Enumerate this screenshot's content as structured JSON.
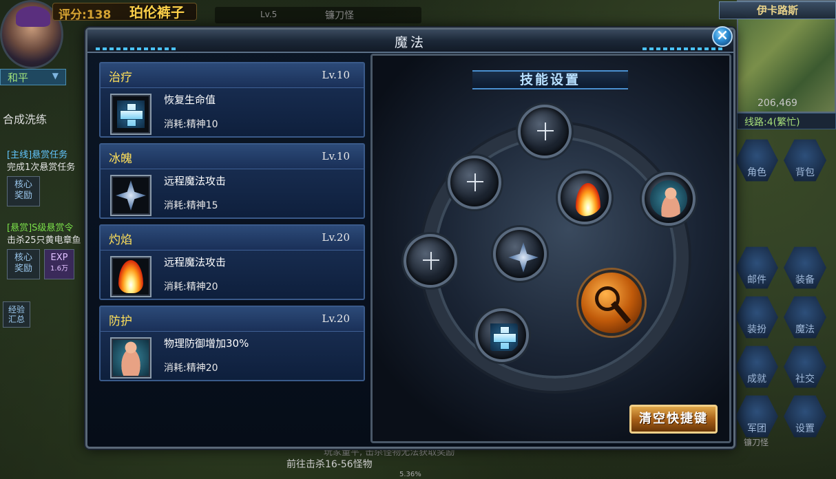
{
  "hud": {
    "score": "评分:138",
    "player_name": "珀伦裤子",
    "target_level": "Lv.5",
    "target_name": "镰刀怪",
    "peace_mode": "和平",
    "synth": "合成洗练",
    "quests": [
      {
        "tag": "[主线]悬赏任务",
        "desc": "完成1次悬赏任务"
      },
      {
        "tag": "[悬赏]S级悬赏令",
        "desc": "击杀25只黄电章鱼"
      }
    ],
    "core_reward": "核心\n奖励",
    "exp_label": "EXP",
    "exp_value": "1.6万",
    "exp_summary": "经验\n汇总",
    "map_name": "伊卡路斯",
    "coords": "206,469",
    "line": "线路:4(繁忙)",
    "menu": [
      "角色",
      "背包",
      "邮件",
      "装备",
      "装扮",
      "魔法",
      "成就",
      "社交",
      "军团",
      "设置"
    ],
    "bottom_hint": "前往击杀16-56怪物",
    "bottom_hint2": "玩家董平, 击杀怪物无法获取奖励",
    "bottom_pct": "5.36%",
    "sub_monster": "镰刀怪"
  },
  "dialog": {
    "title": "魔法",
    "close_icon": "close-icon"
  },
  "skills": [
    {
      "name": "治疗",
      "level": "Lv.10",
      "desc": "恢复生命值",
      "cost": "消耗:精神10",
      "icon": "heal-cross-icon"
    },
    {
      "name": "冰魄",
      "level": "Lv.10",
      "desc": "远程魔法攻击",
      "cost": "消耗:精神15",
      "icon": "ice-shard-icon"
    },
    {
      "name": "灼焰",
      "level": "Lv.20",
      "desc": "远程魔法攻击",
      "cost": "消耗:精神20",
      "icon": "flame-icon"
    },
    {
      "name": "防护",
      "level": "Lv.20",
      "desc": "物理防御增加30%",
      "cost": "消耗:精神20",
      "icon": "body-armor-icon"
    }
  ],
  "settings": {
    "title": "技能设置",
    "clear_button": "清空快捷键"
  },
  "colors": {
    "skill_name": "#ffe05a",
    "accent_blue": "#4bc3ff",
    "button_gold": "#e0a84a"
  }
}
